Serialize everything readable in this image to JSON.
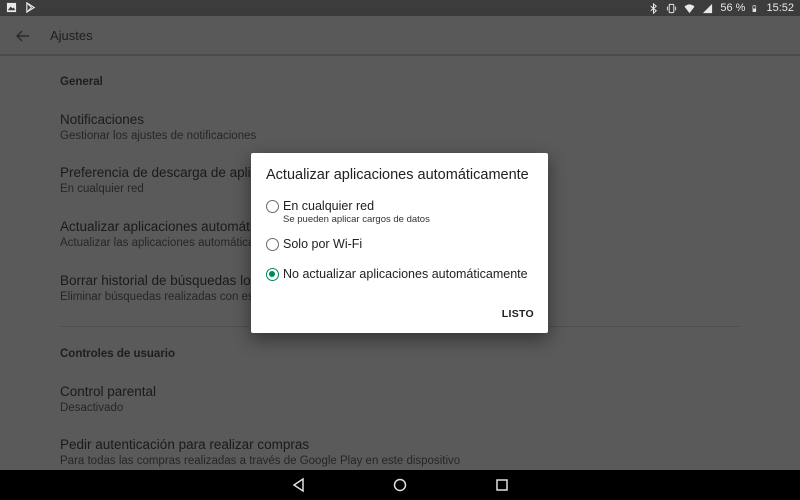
{
  "status_bar": {
    "left_icons": [
      "image-icon",
      "play-store-icon"
    ],
    "right_icons": [
      "bluetooth-icon",
      "vibrate-icon",
      "wifi-icon",
      "signal-icon"
    ],
    "battery_percent": "56 %",
    "time": "15:52"
  },
  "appbar": {
    "title": "Ajustes"
  },
  "settings": {
    "general_header": "General",
    "items": [
      {
        "title": "Notificaciones",
        "subtitle": "Gestionar los ajustes de notificaciones"
      },
      {
        "title": "Preferencia de descarga de aplicaciones",
        "subtitle": "En cualquier red"
      },
      {
        "title": "Actualizar aplicaciones automáticamente",
        "subtitle": "Actualizar las aplicaciones automáticamente"
      },
      {
        "title": "Borrar historial de búsquedas locales",
        "subtitle": "Eliminar búsquedas realizadas con este dispositivo"
      }
    ],
    "user_controls_header": "Controles de usuario",
    "user_items": [
      {
        "title": "Control parental",
        "subtitle": "Desactivado"
      },
      {
        "title": "Pedir autenticación para realizar compras",
        "subtitle": "Para todas las compras realizadas a través de Google Play en este dispositivo"
      }
    ]
  },
  "dialog": {
    "title": "Actualizar aplicaciones automáticamente",
    "options": [
      {
        "label": "En cualquier red",
        "sublabel": "Se pueden aplicar cargos de datos",
        "checked": false
      },
      {
        "label": "Solo por Wi-Fi",
        "sublabel": "",
        "checked": false
      },
      {
        "label": "No actualizar aplicaciones automáticamente",
        "sublabel": "",
        "checked": true
      }
    ],
    "confirm_label": "LISTO"
  },
  "colors": {
    "accent": "#01875f",
    "scrim": "#5a5a5a"
  },
  "nav": {
    "icons": [
      "back-triangle-icon",
      "home-circle-icon",
      "recents-square-icon"
    ]
  }
}
